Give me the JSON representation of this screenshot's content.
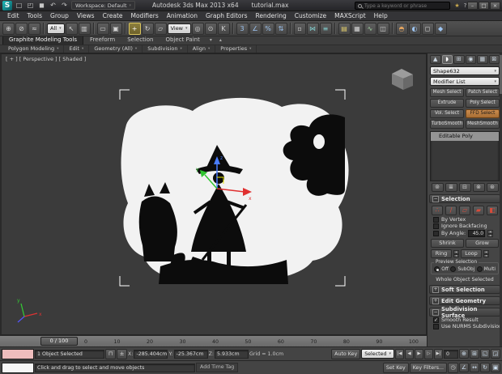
{
  "title_bar": {
    "workspace_label": "Workspace: Default",
    "app_title": "Autodesk 3ds Max 2013 x64",
    "file_name": "tutorial.max",
    "search_placeholder": "Type a keyword or phrase"
  },
  "menu": {
    "items": [
      "Edit",
      "Tools",
      "Group",
      "Views",
      "Create",
      "Modifiers",
      "Animation",
      "Graph Editors",
      "Rendering",
      "Customize",
      "MAXScript",
      "Help"
    ]
  },
  "toolbar": {
    "selection_filter_value": "All",
    "coord_system_value": "View"
  },
  "ribbon": {
    "tabs": [
      {
        "label": "Graphite Modeling Tools"
      },
      {
        "label": "Freeform"
      },
      {
        "label": "Selection"
      },
      {
        "label": "Object Paint"
      }
    ],
    "panels": [
      "Polygon Modeling",
      "Edit",
      "Geometry (All)",
      "Subdivision",
      "Align",
      "Properties"
    ]
  },
  "viewport": {
    "label": "[ + ] [ Perspective ] [ Shaded ]",
    "axis_x": "x",
    "axis_y": "y",
    "axis_z": "z"
  },
  "command_panel": {
    "object_name": "Shape632",
    "modifier_list": "Modifier List",
    "modifier_buttons": [
      "Mesh Select",
      "Patch Select",
      "Extrude",
      "Poly Select",
      "Vol. Select",
      "FFD Select",
      "TurboSmooth",
      "MeshSmooth"
    ],
    "stack": [
      "Editable Poly"
    ],
    "selection_rollout": {
      "title": "Selection",
      "by_vertex": "By Vertex",
      "ignore_backfacing": "Ignore Backfacing",
      "by_angle": "By Angle:",
      "by_angle_value": "45.0",
      "shrink": "Shrink",
      "grow": "Grow",
      "ring": "Ring",
      "loop": "Loop",
      "preview_label": "Preview Selection",
      "preview_options": [
        "Off",
        "SubObj",
        "Multi"
      ],
      "status": "Whole Object Selected"
    },
    "soft_selection_title": "Soft Selection",
    "edit_geometry_title": "Edit Geometry",
    "subdivision_title": "Subdivision Surface",
    "smooth_result": "Smooth Result",
    "use_nurms": "Use NURMS Subdivision"
  },
  "timeline": {
    "slider_value": "0 / 100",
    "ticks": [
      "0",
      "10",
      "20",
      "30",
      "40",
      "50",
      "60",
      "70",
      "80",
      "90",
      "100"
    ]
  },
  "status_bar": {
    "selection_status": "1 Object Selected",
    "prompt": "Click and drag to select and move objects",
    "x_label": "X:",
    "x_value": "-285.404cm",
    "y_label": "Y:",
    "y_value": "-25.367cm",
    "z_label": "Z:",
    "z_value": "5.933cm",
    "grid": "Grid = 1.0cm",
    "add_time_tag": "Add Time Tag",
    "auto_key": "Auto Key",
    "set_key": "Set Key",
    "selected_dropdown": "Selected",
    "key_filters": "Key Filters...",
    "frame": "0"
  },
  "icons": {
    "app_logo": "S",
    "dropdown_arrow": "▾",
    "new_scene": "□",
    "open_file": "◰",
    "save_file": "◼",
    "undo": "↶",
    "redo": "↷",
    "star": "★",
    "help": "?",
    "minimize": "–",
    "maximize": "□",
    "close": "×",
    "select_link": "⊕",
    "unlink": "⊘",
    "bind_spacewarp": "≈",
    "select_object": "↖",
    "select_by_name": "▥",
    "selection_region": "▭",
    "window_crossing": "▣",
    "move": "+",
    "rotate": "↻",
    "scale": "▱",
    "use_center": "◎",
    "select_manipulate": "⊙",
    "keyboard_override": "K",
    "snap_3d": "3",
    "angle_snap": "∠",
    "percent_snap": "%",
    "spinner_snap": "⇅",
    "named_sets": "▫",
    "mirror": "⋈",
    "align": "≡",
    "layer_manager": "▤",
    "ribbon_toggle": "▦",
    "curve_editor": "∿",
    "schematic_view": "◫",
    "material_editor": "◓",
    "render_setup": "◐",
    "rendered_frame": "◻",
    "render_production": "◆",
    "create_tab": "▲",
    "modify_tab": "◗",
    "hierarchy_tab": "⊞",
    "motion_tab": "◉",
    "display_tab": "▦",
    "utilities_tab": "⊠",
    "pin_stack": "⊚",
    "show_end_result": "≣",
    "make_unique": "⊟",
    "remove_modifier": "⊗",
    "configure_sets": "⊛",
    "vertex_sub": "∴",
    "edge_sub": "∕",
    "border_sub": "▱",
    "polygon_sub": "▰",
    "element_sub": "◧",
    "spin_up": "▴",
    "spin_down": "▾",
    "check": "✓",
    "plus": "+",
    "minus": "−",
    "lock": "⊓",
    "abs_offset": "±",
    "play_start": "|◀",
    "frame_prev": "◀",
    "play": "▶",
    "frame_next": "▷",
    "play_end": "▶|",
    "time_config": "◷",
    "zoom": "⊕",
    "zoom_all": "⊞",
    "zoom_extents": "◱",
    "zoom_extents_all": "◲",
    "fov": "∠",
    "pan": "↔",
    "orbit": "↻",
    "maximize_viewport": "▣"
  }
}
